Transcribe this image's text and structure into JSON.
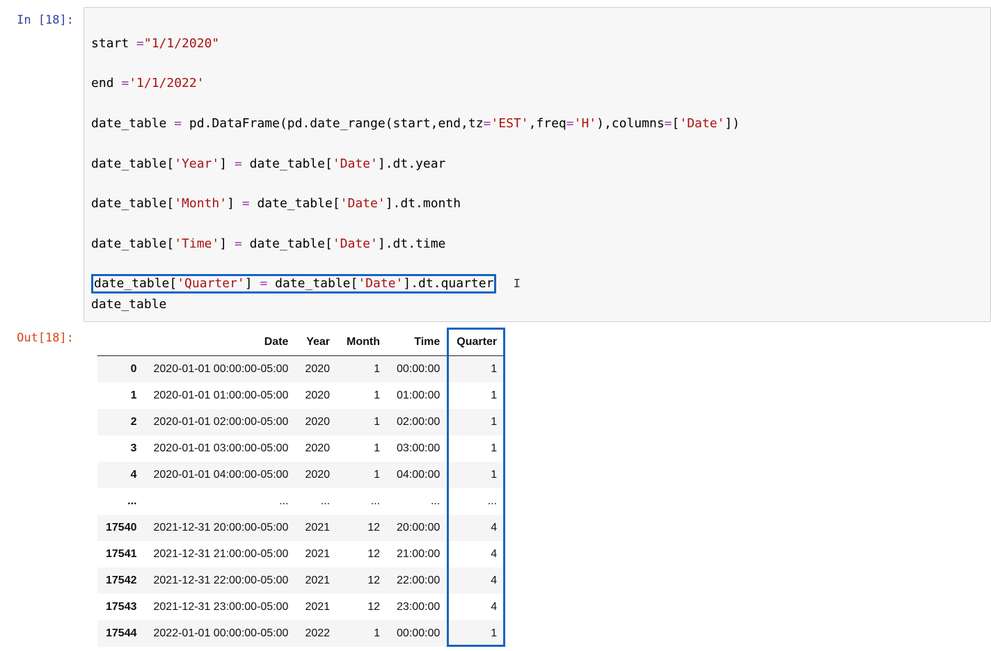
{
  "cell": {
    "in_prompt": "In [18]:",
    "out_prompt": "Out[18]:",
    "code": {
      "l1_a": "start ",
      "l1_b": "=",
      "l1_c": "\"1/1/2020\"",
      "l2_a": "end ",
      "l2_b": "=",
      "l2_c": "'1/1/2022'",
      "l3_a": "date_table ",
      "l3_b": "=",
      "l3_c": " pd.DataFrame(pd.date_range(start,end,tz",
      "l3_d": "=",
      "l3_e": "'EST'",
      "l3_f": ",freq",
      "l3_g": "=",
      "l3_h": "'H'",
      "l3_i": "),columns",
      "l3_j": "=",
      "l3_k": "[",
      "l3_l": "'Date'",
      "l3_m": "])",
      "l4_a": "date_table[",
      "l4_b": "'Year'",
      "l4_c": "] ",
      "l4_d": "=",
      "l4_e": " date_table[",
      "l4_f": "'Date'",
      "l4_g": "].dt.year",
      "l5_a": "date_table[",
      "l5_b": "'Month'",
      "l5_c": "] ",
      "l5_d": "=",
      "l5_e": " date_table[",
      "l5_f": "'Date'",
      "l5_g": "].dt.month",
      "l6_a": "date_table[",
      "l6_b": "'Time'",
      "l6_c": "] ",
      "l6_d": "=",
      "l6_e": " date_table[",
      "l6_f": "'Date'",
      "l6_g": "].dt.time",
      "l7_a": "date_table[",
      "l7_b": "'Quarter'",
      "l7_c": "] ",
      "l7_d": "=",
      "l7_e": " date_table[",
      "l7_f": "'Date'",
      "l7_g": "].dt.quarter",
      "l8": "date_table"
    }
  },
  "table": {
    "columns": [
      "",
      "Date",
      "Year",
      "Month",
      "Time",
      "Quarter"
    ],
    "rows": [
      {
        "idx": "0",
        "Date": "2020-01-01 00:00:00-05:00",
        "Year": "2020",
        "Month": "1",
        "Time": "00:00:00",
        "Quarter": "1"
      },
      {
        "idx": "1",
        "Date": "2020-01-01 01:00:00-05:00",
        "Year": "2020",
        "Month": "1",
        "Time": "01:00:00",
        "Quarter": "1"
      },
      {
        "idx": "2",
        "Date": "2020-01-01 02:00:00-05:00",
        "Year": "2020",
        "Month": "1",
        "Time": "02:00:00",
        "Quarter": "1"
      },
      {
        "idx": "3",
        "Date": "2020-01-01 03:00:00-05:00",
        "Year": "2020",
        "Month": "1",
        "Time": "03:00:00",
        "Quarter": "1"
      },
      {
        "idx": "4",
        "Date": "2020-01-01 04:00:00-05:00",
        "Year": "2020",
        "Month": "1",
        "Time": "04:00:00",
        "Quarter": "1"
      },
      {
        "idx": "...",
        "Date": "...",
        "Year": "...",
        "Month": "...",
        "Time": "...",
        "Quarter": "..."
      },
      {
        "idx": "17540",
        "Date": "2021-12-31 20:00:00-05:00",
        "Year": "2021",
        "Month": "12",
        "Time": "20:00:00",
        "Quarter": "4"
      },
      {
        "idx": "17541",
        "Date": "2021-12-31 21:00:00-05:00",
        "Year": "2021",
        "Month": "12",
        "Time": "21:00:00",
        "Quarter": "4"
      },
      {
        "idx": "17542",
        "Date": "2021-12-31 22:00:00-05:00",
        "Year": "2021",
        "Month": "12",
        "Time": "22:00:00",
        "Quarter": "4"
      },
      {
        "idx": "17543",
        "Date": "2021-12-31 23:00:00-05:00",
        "Year": "2021",
        "Month": "12",
        "Time": "23:00:00",
        "Quarter": "4"
      },
      {
        "idx": "17544",
        "Date": "2022-01-01 00:00:00-05:00",
        "Year": "2022",
        "Month": "1",
        "Time": "00:00:00",
        "Quarter": "1"
      }
    ]
  }
}
